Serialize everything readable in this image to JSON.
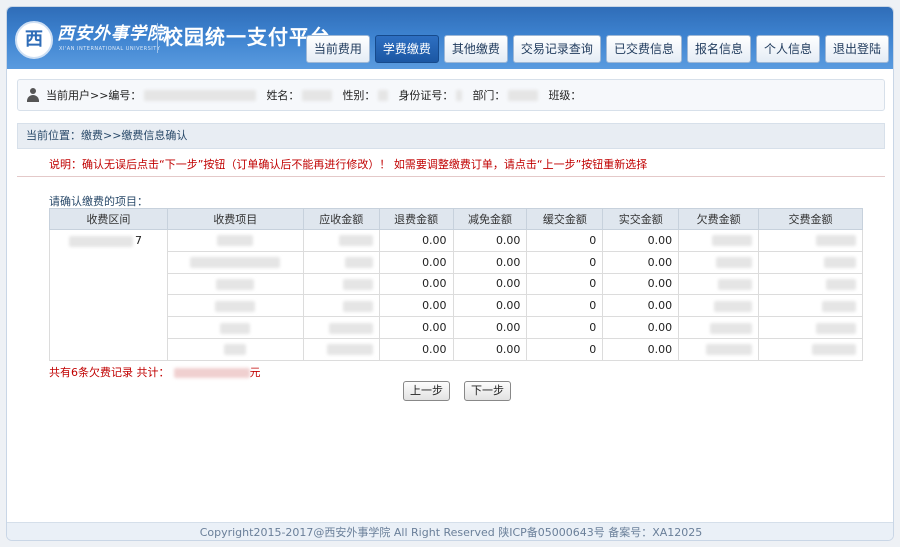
{
  "header": {
    "logo_cn": "西安外事学院",
    "logo_en": "XI'AN INTERNATIONAL UNIVERSITY",
    "platform_title": "校园统一支付平台"
  },
  "nav": [
    {
      "label": "当前费用",
      "active": false
    },
    {
      "label": "学费缴费",
      "active": true
    },
    {
      "label": "其他缴费",
      "active": false
    },
    {
      "label": "交易记录查询",
      "active": false
    },
    {
      "label": "已交费信息",
      "active": false
    },
    {
      "label": "报名信息",
      "active": false
    },
    {
      "label": "个人信息",
      "active": false
    },
    {
      "label": "退出登陆",
      "active": false
    }
  ],
  "user_bar": {
    "current_user_label": "当前用户>>编号：",
    "name_label": "姓名：",
    "gender_label": "性别：",
    "id_label": "身份证号：",
    "dept_label": "部门：",
    "class_label": "班级："
  },
  "location": "当前位置：缴费>>缴费信息确认",
  "notice": "说明：确认无误后点击“下一步”按钮（订单确认后不能再进行修改）！ 如需要调整缴费订单，请点击“上一步”按钮重新选择",
  "confirm_label": "请确认缴费的项目：",
  "table": {
    "headers": [
      "收费区间",
      "收费项目",
      "应收金额",
      "退费金额",
      "减免金额",
      "缓交金额",
      "实交金额",
      "欠费金额",
      "交费金额"
    ],
    "period_suffix": "7",
    "rows": [
      {
        "refund": "0.00",
        "waiver": "0.00",
        "deferred": "0",
        "paid": "0.00"
      },
      {
        "refund": "0.00",
        "waiver": "0.00",
        "deferred": "0",
        "paid": "0.00"
      },
      {
        "refund": "0.00",
        "waiver": "0.00",
        "deferred": "0",
        "paid": "0.00"
      },
      {
        "refund": "0.00",
        "waiver": "0.00",
        "deferred": "0",
        "paid": "0.00"
      },
      {
        "refund": "0.00",
        "waiver": "0.00",
        "deferred": "0",
        "paid": "0.00"
      },
      {
        "refund": "0.00",
        "waiver": "0.00",
        "deferred": "0",
        "paid": "0.00"
      }
    ]
  },
  "summary": {
    "prefix": "共有6条欠费记录  共计：",
    "suffix": "元"
  },
  "buttons": {
    "prev": "上一步",
    "next": "下一步"
  },
  "footer": "Copyright2015-2017@西安外事学院   All Right Reserved   陕ICP备05000643号   备案号：XA12025"
}
